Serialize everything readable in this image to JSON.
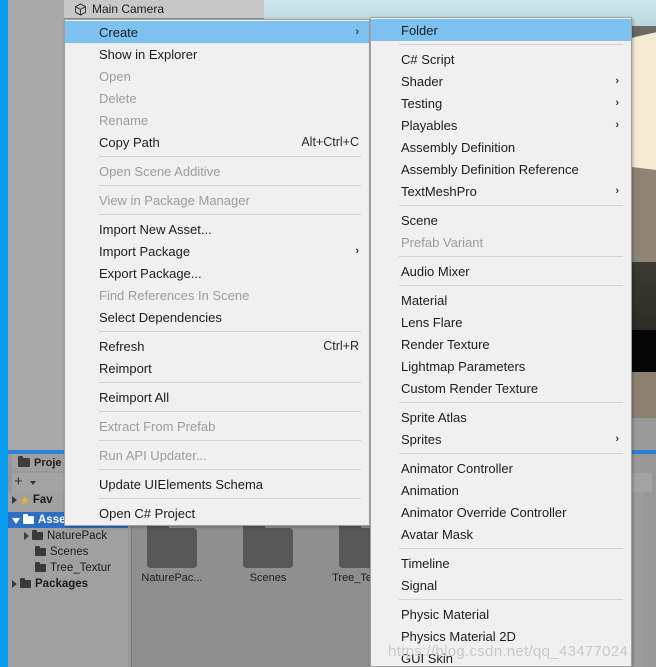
{
  "hierarchy": {
    "selected_object": "Main Camera",
    "icon": "cube-icon"
  },
  "project_panel": {
    "tab_label": "Proje",
    "add_button": "+",
    "favorites_label": "Fav",
    "tree": [
      {
        "label": "Assets",
        "selected": true,
        "expanded": true,
        "indent": 0
      },
      {
        "label": "NaturePack",
        "selected": false,
        "expanded": false,
        "indent": 1
      },
      {
        "label": "Scenes",
        "selected": false,
        "expanded": null,
        "indent": 1
      },
      {
        "label": "Tree_Textur",
        "selected": false,
        "expanded": null,
        "indent": 1
      },
      {
        "label": "Packages",
        "selected": false,
        "expanded": false,
        "indent": 0
      }
    ],
    "assets": [
      {
        "label": "NaturePac...",
        "icon": "folder-icon"
      },
      {
        "label": "Scenes",
        "icon": "folder-icon"
      },
      {
        "label": "Tree_Textu...",
        "icon": "folder-icon"
      }
    ],
    "search_icon": "search-icon"
  },
  "context_menu": {
    "items": [
      {
        "label": "Create",
        "shortcut": "",
        "submenu": true,
        "disabled": false,
        "highlighted": true
      },
      {
        "label": "Show in Explorer",
        "shortcut": "",
        "submenu": false,
        "disabled": false,
        "highlighted": false
      },
      {
        "label": "Open",
        "shortcut": "",
        "submenu": false,
        "disabled": true,
        "highlighted": false
      },
      {
        "label": "Delete",
        "shortcut": "",
        "submenu": false,
        "disabled": true,
        "highlighted": false
      },
      {
        "label": "Rename",
        "shortcut": "",
        "submenu": false,
        "disabled": true,
        "highlighted": false
      },
      {
        "label": "Copy Path",
        "shortcut": "Alt+Ctrl+C",
        "submenu": false,
        "disabled": false,
        "highlighted": false
      },
      {
        "separator": true
      },
      {
        "label": "Open Scene Additive",
        "shortcut": "",
        "submenu": false,
        "disabled": true,
        "highlighted": false
      },
      {
        "separator": true
      },
      {
        "label": "View in Package Manager",
        "shortcut": "",
        "submenu": false,
        "disabled": true,
        "highlighted": false
      },
      {
        "separator": true
      },
      {
        "label": "Import New Asset...",
        "shortcut": "",
        "submenu": false,
        "disabled": false,
        "highlighted": false
      },
      {
        "label": "Import Package",
        "shortcut": "",
        "submenu": true,
        "disabled": false,
        "highlighted": false
      },
      {
        "label": "Export Package...",
        "shortcut": "",
        "submenu": false,
        "disabled": false,
        "highlighted": false
      },
      {
        "label": "Find References In Scene",
        "shortcut": "",
        "submenu": false,
        "disabled": true,
        "highlighted": false
      },
      {
        "label": "Select Dependencies",
        "shortcut": "",
        "submenu": false,
        "disabled": false,
        "highlighted": false
      },
      {
        "separator": true
      },
      {
        "label": "Refresh",
        "shortcut": "Ctrl+R",
        "submenu": false,
        "disabled": false,
        "highlighted": false
      },
      {
        "label": "Reimport",
        "shortcut": "",
        "submenu": false,
        "disabled": false,
        "highlighted": false
      },
      {
        "separator": true
      },
      {
        "label": "Reimport All",
        "shortcut": "",
        "submenu": false,
        "disabled": false,
        "highlighted": false
      },
      {
        "separator": true
      },
      {
        "label": "Extract From Prefab",
        "shortcut": "",
        "submenu": false,
        "disabled": true,
        "highlighted": false
      },
      {
        "separator": true
      },
      {
        "label": "Run API Updater...",
        "shortcut": "",
        "submenu": false,
        "disabled": true,
        "highlighted": false
      },
      {
        "separator": true
      },
      {
        "label": "Update UIElements Schema",
        "shortcut": "",
        "submenu": false,
        "disabled": false,
        "highlighted": false
      },
      {
        "separator": true
      },
      {
        "label": "Open C# Project",
        "shortcut": "",
        "submenu": false,
        "disabled": false,
        "highlighted": false
      }
    ]
  },
  "create_submenu": {
    "items": [
      {
        "label": "Folder",
        "submenu": false,
        "disabled": false,
        "highlighted": true
      },
      {
        "separator": true
      },
      {
        "label": "C# Script",
        "submenu": false,
        "disabled": false,
        "highlighted": false
      },
      {
        "label": "Shader",
        "submenu": true,
        "disabled": false,
        "highlighted": false
      },
      {
        "label": "Testing",
        "submenu": true,
        "disabled": false,
        "highlighted": false
      },
      {
        "label": "Playables",
        "submenu": true,
        "disabled": false,
        "highlighted": false
      },
      {
        "label": "Assembly Definition",
        "submenu": false,
        "disabled": false,
        "highlighted": false
      },
      {
        "label": "Assembly Definition Reference",
        "submenu": false,
        "disabled": false,
        "highlighted": false
      },
      {
        "label": "TextMeshPro",
        "submenu": true,
        "disabled": false,
        "highlighted": false
      },
      {
        "separator": true
      },
      {
        "label": "Scene",
        "submenu": false,
        "disabled": false,
        "highlighted": false
      },
      {
        "label": "Prefab Variant",
        "submenu": false,
        "disabled": true,
        "highlighted": false
      },
      {
        "separator": true
      },
      {
        "label": "Audio Mixer",
        "submenu": false,
        "disabled": false,
        "highlighted": false
      },
      {
        "separator": true
      },
      {
        "label": "Material",
        "submenu": false,
        "disabled": false,
        "highlighted": false
      },
      {
        "label": "Lens Flare",
        "submenu": false,
        "disabled": false,
        "highlighted": false
      },
      {
        "label": "Render Texture",
        "submenu": false,
        "disabled": false,
        "highlighted": false
      },
      {
        "label": "Lightmap Parameters",
        "submenu": false,
        "disabled": false,
        "highlighted": false
      },
      {
        "label": "Custom Render Texture",
        "submenu": false,
        "disabled": false,
        "highlighted": false
      },
      {
        "separator": true
      },
      {
        "label": "Sprite Atlas",
        "submenu": false,
        "disabled": false,
        "highlighted": false
      },
      {
        "label": "Sprites",
        "submenu": true,
        "disabled": false,
        "highlighted": false
      },
      {
        "separator": true
      },
      {
        "label": "Animator Controller",
        "submenu": false,
        "disabled": false,
        "highlighted": false
      },
      {
        "label": "Animation",
        "submenu": false,
        "disabled": false,
        "highlighted": false
      },
      {
        "label": "Animator Override Controller",
        "submenu": false,
        "disabled": false,
        "highlighted": false
      },
      {
        "label": "Avatar Mask",
        "submenu": false,
        "disabled": false,
        "highlighted": false
      },
      {
        "separator": true
      },
      {
        "label": "Timeline",
        "submenu": false,
        "disabled": false,
        "highlighted": false
      },
      {
        "label": "Signal",
        "submenu": false,
        "disabled": false,
        "highlighted": false
      },
      {
        "separator": true
      },
      {
        "label": "Physic Material",
        "submenu": false,
        "disabled": false,
        "highlighted": false
      },
      {
        "label": "Physics Material 2D",
        "submenu": false,
        "disabled": false,
        "highlighted": false
      },
      {
        "label": "GUI Skin",
        "submenu": false,
        "disabled": false,
        "highlighted": false
      }
    ]
  },
  "watermark": {
    "text": "https://blog.csdn.net/qq_43477024"
  },
  "colors": {
    "highlight": "#7cc1f0",
    "menu_bg": "#f0f0f0",
    "accent": "#0a9cf0",
    "tree_selected": "#2d6fc4"
  }
}
